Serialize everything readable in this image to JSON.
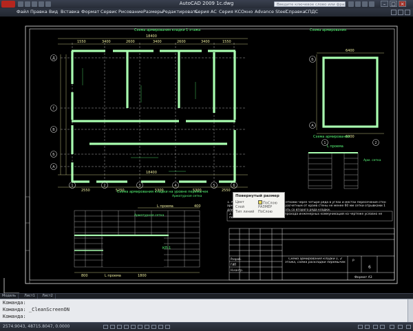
{
  "window": {
    "title": "AutoCAD 2009 1c.dwg",
    "search_placeholder": "Введите ключевое слово или фразу"
  },
  "menu": [
    "Файл",
    "Правка",
    "Вид",
    "Вставка",
    "Формат",
    "Сервис",
    "Рисование",
    "Размеры",
    "Редактировать",
    "Серия АС",
    "Серия КС",
    "Окно",
    "Advance Steel",
    "Справка",
    "СПДС"
  ],
  "drawing": {
    "plan_title": "Схема армирования кладки 1 этажа",
    "plan_title_right": "Схема армирования",
    "dims_top": [
      "1550",
      "3400",
      "2600",
      "3400",
      "2600",
      "3400",
      "1550"
    ],
    "dim_overall_top": "18400",
    "dims_bottom": [
      "2550",
      "5250",
      "5300",
      "5300",
      "2550"
    ],
    "dim_overall_bottom": "18400",
    "dim_right_top": "6400",
    "dim_right_bottom": "6000",
    "axes_vertical": [
      "1",
      "2",
      "3",
      "4",
      "5",
      "6"
    ],
    "axes_horizontal": [
      "А",
      "Б",
      "В",
      "Г",
      "Д"
    ],
    "axes_right": [
      "А",
      "Б"
    ],
    "axes_right_bottom": [
      "1",
      "2"
    ],
    "section_left_title": "Схема армирования кладки на уровне перемычек",
    "section_right_title": "Схема армирования",
    "section_subtitle": "L проема",
    "section_label": "L проема",
    "section_dim_400": "400",
    "section_dim_800": "800",
    "section_dim_1800": "1800",
    "mesh_label_1": "Арматурная сетка",
    "mesh_label_2": "Арматурная сетка",
    "mesh_label_3": "Арм. сетка",
    "kp_label": "КП-1",
    "note_1": "1. Армирование кладки выполнять сетками через четыре ряда в углах и местах пересечения стен арматурной проволокой Ø3-Вр-1 по расчетным от краев стены не менее 60 мм сетки отрывками 1 длиной 600 мм. Армирование начинать со второго ряда кладки.",
    "note_2": "2. Отверстия, ниши и штрабы для прохода инженерных коммуникаций на чертеже условно не показаны.",
    "stamp_text": "Схема армирования кладки 1, 2 этажа, схема раскладки перемычек",
    "stamp_sheet": "6",
    "stamp_stage": "Р",
    "stamp_format": "Формат А3",
    "stamp_labels": [
      "Разраб.",
      "ГИП",
      "Н.контр."
    ]
  },
  "tooltip": {
    "title": "Повернутый размер",
    "rows": [
      {
        "label": "Цвет",
        "value": "ПоСлою"
      },
      {
        "label": "Слой",
        "value": "РАЗМЕР"
      },
      {
        "label": "Тип линий",
        "value": "ПоСлою"
      }
    ],
    "swatch_color": "#e8d85a"
  },
  "layout_tabs": [
    "Модель",
    "Лист1",
    "Лист2"
  ],
  "command": {
    "lines": [
      "Команда:",
      "Команда: _CleanScreenON",
      "Команда:"
    ]
  },
  "status": {
    "coords": "2574.9043, 48715.8047, 0.0000"
  },
  "colors": {
    "canvas": "#000000",
    "wall": "#a9ffb0",
    "annotation": "#59ff7a",
    "dimension": "#f0f0a0",
    "frame": "#e8e8e8",
    "axes": "#d8d8d8"
  }
}
